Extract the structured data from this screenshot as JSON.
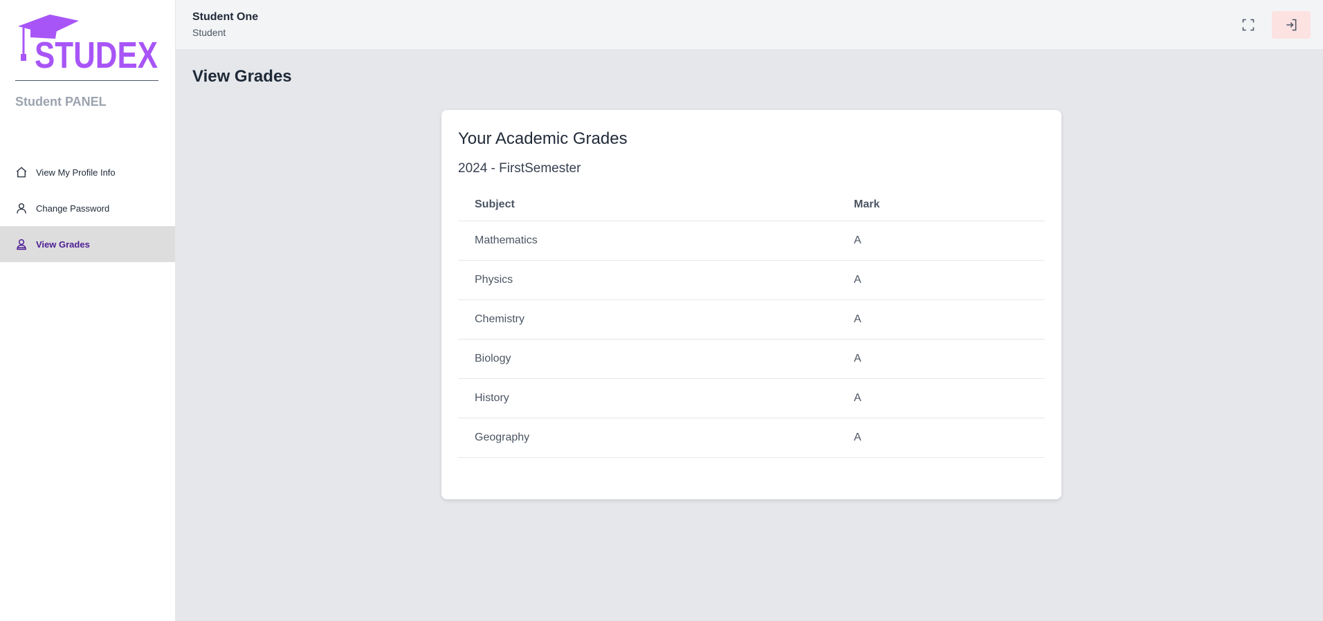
{
  "sidebar": {
    "logo_text": "STUDEX",
    "panel_title": "Student PANEL",
    "items": [
      {
        "label": "View My Profile Info",
        "icon": "home-icon",
        "active": false
      },
      {
        "label": "Change Password",
        "icon": "user-icon",
        "active": false
      },
      {
        "label": "View Grades",
        "icon": "user-badge-icon",
        "active": true
      }
    ]
  },
  "header": {
    "user_name": "Student One",
    "user_role": "Student",
    "fullscreen_icon": "fullscreen-icon",
    "logout_icon": "logout-icon"
  },
  "main": {
    "page_title": "View Grades",
    "card": {
      "title": "Your Academic Grades",
      "semester": "2024 - FirstSemester",
      "columns": [
        "Subject",
        "Mark"
      ],
      "rows": [
        {
          "subject": "Mathematics",
          "mark": "A"
        },
        {
          "subject": "Physics",
          "mark": "A"
        },
        {
          "subject": "Chemistry",
          "mark": "A"
        },
        {
          "subject": "Biology",
          "mark": "A"
        },
        {
          "subject": "History",
          "mark": "A"
        },
        {
          "subject": "Geography",
          "mark": "A"
        }
      ]
    }
  },
  "colors": {
    "brand_purple": "#a855f7",
    "active_nav_text": "#4c1d95",
    "logout_bg": "#fde2e2"
  }
}
